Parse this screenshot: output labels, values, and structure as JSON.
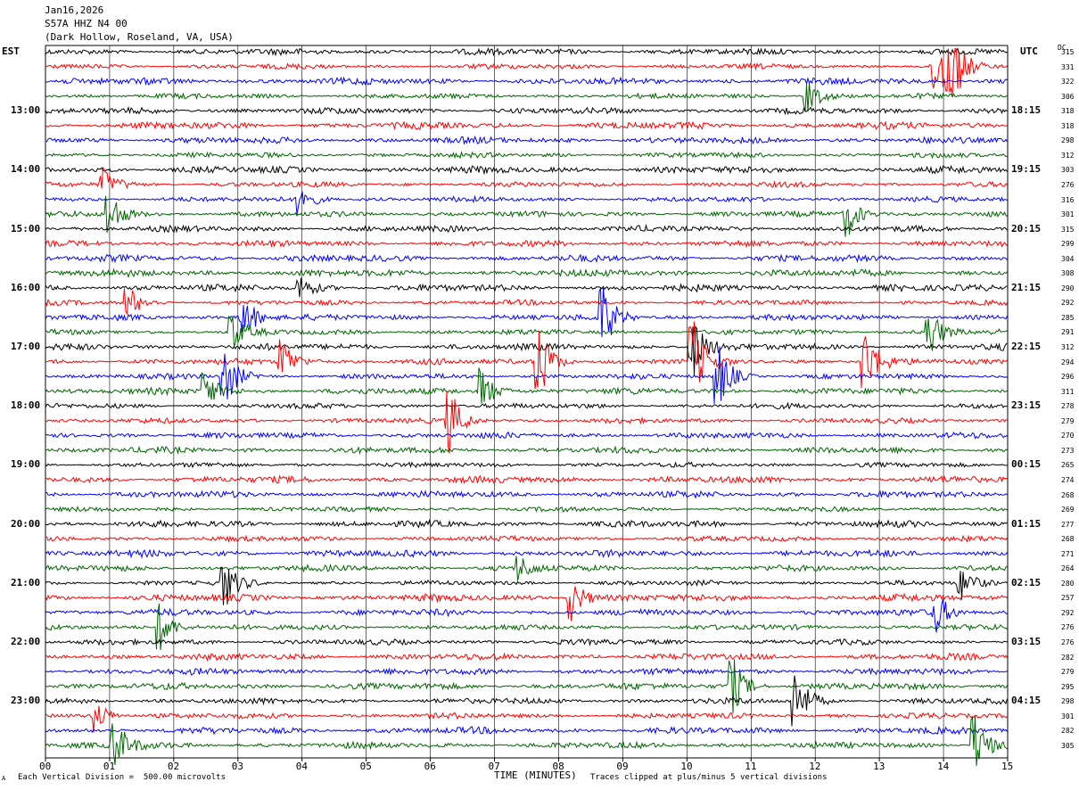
{
  "header": {
    "date": "Jan16,2026",
    "station": "S57A HHZ N4 00",
    "location": "(Dark Hollow, Roseland, VA, USA)",
    "left_tz": "EST",
    "right_tz": "UTC",
    "dc_label": "DC"
  },
  "footer": {
    "scale_note": "Each Vertical Division =  500.00 microvolts",
    "xlabel": "TIME (MINUTES)",
    "clip_note": "Traces clipped at plus/minus 5 vertical divisions",
    "corner_mark": "A"
  },
  "colors": {
    "trace_cycle": [
      "#000000",
      "#ff0000",
      "#0000ff",
      "#006400"
    ],
    "grid": "#000000"
  },
  "chart_data": {
    "type": "line",
    "xlabel": "TIME (MINUTES)",
    "x_ticks": [
      "00",
      "01",
      "02",
      "03",
      "04",
      "05",
      "06",
      "07",
      "08",
      "09",
      "10",
      "11",
      "12",
      "13",
      "14",
      "15"
    ],
    "xlim": [
      0,
      15
    ],
    "trace_count": 48,
    "left_hour_labels": [
      {
        "trace": 4,
        "label": "13:00"
      },
      {
        "trace": 8,
        "label": "14:00"
      },
      {
        "trace": 12,
        "label": "15:00"
      },
      {
        "trace": 16,
        "label": "16:00"
      },
      {
        "trace": 20,
        "label": "17:00"
      },
      {
        "trace": 24,
        "label": "18:00"
      },
      {
        "trace": 28,
        "label": "19:00"
      },
      {
        "trace": 32,
        "label": "20:00"
      },
      {
        "trace": 36,
        "label": "21:00"
      },
      {
        "trace": 40,
        "label": "22:00"
      },
      {
        "trace": 44,
        "label": "23:00"
      }
    ],
    "right_hour_labels": [
      {
        "trace": 4,
        "label": "18:15"
      },
      {
        "trace": 8,
        "label": "19:15"
      },
      {
        "trace": 12,
        "label": "20:15"
      },
      {
        "trace": 16,
        "label": "21:15"
      },
      {
        "trace": 20,
        "label": "22:15"
      },
      {
        "trace": 24,
        "label": "23:15"
      },
      {
        "trace": 28,
        "label": "00:15"
      },
      {
        "trace": 32,
        "label": "01:15"
      },
      {
        "trace": 36,
        "label": "02:15"
      },
      {
        "trace": 40,
        "label": "03:15"
      },
      {
        "trace": 44,
        "label": "04:15"
      }
    ],
    "dc_offsets": [
      "315",
      "331",
      "322",
      "306",
      "318",
      "318",
      "298",
      "312",
      "303",
      "276",
      "316",
      "301",
      "315",
      "299",
      "304",
      "308",
      "290",
      "292",
      "285",
      "291",
      "312",
      "294",
      "296",
      "311",
      "278",
      "279",
      "270",
      "273",
      "265",
      "274",
      "268",
      "269",
      "277",
      "268",
      "271",
      "264",
      "280",
      "257",
      "292",
      "276",
      "276",
      "282",
      "279",
      "295",
      "298",
      "301",
      "282",
      "305"
    ],
    "events": [
      {
        "trace": 1,
        "minute": 13.9,
        "amp": 5
      },
      {
        "trace": 1,
        "minute": 14.1,
        "amp": 5
      },
      {
        "trace": 3,
        "minute": 11.9,
        "amp": 2
      },
      {
        "trace": 9,
        "minute": 0.9,
        "amp": 2
      },
      {
        "trace": 10,
        "minute": 4.0,
        "amp": 2
      },
      {
        "trace": 11,
        "minute": 1.0,
        "amp": 3
      },
      {
        "trace": 11,
        "minute": 12.5,
        "amp": 3
      },
      {
        "trace": 16,
        "minute": 4.0,
        "amp": 1.5
      },
      {
        "trace": 17,
        "minute": 1.3,
        "amp": 2
      },
      {
        "trace": 18,
        "minute": 3.1,
        "amp": 3
      },
      {
        "trace": 18,
        "minute": 8.7,
        "amp": 4
      },
      {
        "trace": 19,
        "minute": 2.9,
        "amp": 2.5
      },
      {
        "trace": 19,
        "minute": 13.8,
        "amp": 3
      },
      {
        "trace": 20,
        "minute": 10.1,
        "amp": 4
      },
      {
        "trace": 21,
        "minute": 7.7,
        "amp": 5
      },
      {
        "trace": 21,
        "minute": 10.1,
        "amp": 5
      },
      {
        "trace": 21,
        "minute": 3.7,
        "amp": 3
      },
      {
        "trace": 21,
        "minute": 12.8,
        "amp": 4
      },
      {
        "trace": 22,
        "minute": 10.5,
        "amp": 4
      },
      {
        "trace": 22,
        "minute": 2.8,
        "amp": 4
      },
      {
        "trace": 23,
        "minute": 6.8,
        "amp": 3
      },
      {
        "trace": 23,
        "minute": 2.5,
        "amp": 2.5
      },
      {
        "trace": 25,
        "minute": 6.3,
        "amp": 4
      },
      {
        "trace": 35,
        "minute": 7.4,
        "amp": 1.5
      },
      {
        "trace": 36,
        "minute": 2.8,
        "amp": 3
      },
      {
        "trace": 36,
        "minute": 14.3,
        "amp": 2
      },
      {
        "trace": 37,
        "minute": 8.2,
        "amp": 3
      },
      {
        "trace": 38,
        "minute": 13.9,
        "amp": 2.5
      },
      {
        "trace": 39,
        "minute": 1.8,
        "amp": 3
      },
      {
        "trace": 43,
        "minute": 10.7,
        "amp": 4
      },
      {
        "trace": 44,
        "minute": 11.7,
        "amp": 4
      },
      {
        "trace": 45,
        "minute": 0.8,
        "amp": 2
      },
      {
        "trace": 47,
        "minute": 1.1,
        "amp": 3
      },
      {
        "trace": 47,
        "minute": 14.5,
        "amp": 4
      }
    ]
  }
}
